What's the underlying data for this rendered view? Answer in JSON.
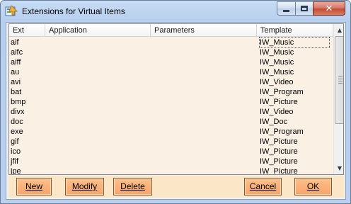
{
  "window": {
    "title": "Extensions for Virtual Items",
    "close_symbol": "✕"
  },
  "list": {
    "columns": [
      "Ext",
      "Application",
      "Parameters",
      "Template"
    ],
    "rows": [
      {
        "ext": "aif",
        "template": "IW_Music"
      },
      {
        "ext": "aifc",
        "template": "IW_Music"
      },
      {
        "ext": "aiff",
        "template": "IW_Music"
      },
      {
        "ext": "au",
        "template": "IW_Music"
      },
      {
        "ext": "avi",
        "template": "IW_Video"
      },
      {
        "ext": "bat",
        "template": "IW_Program"
      },
      {
        "ext": "bmp",
        "template": "IW_Picture"
      },
      {
        "ext": "divx",
        "template": "IW_Video"
      },
      {
        "ext": "doc",
        "template": "IW_Doc"
      },
      {
        "ext": "exe",
        "template": "IW_Program"
      },
      {
        "ext": "gif",
        "template": "IW_Picture"
      },
      {
        "ext": "ico",
        "template": "IW_Picture"
      },
      {
        "ext": "jfif",
        "template": "IW_Picture"
      },
      {
        "ext": "jpe",
        "template": "IW_Picture"
      }
    ]
  },
  "scrollbar": {
    "up_symbol": "▲",
    "down_symbol": "▼"
  },
  "buttons": {
    "new": "New",
    "modify": "Modify",
    "delete": "Delete",
    "cancel": "Cancel",
    "ok": "OK"
  },
  "colors": {
    "list_background": "#fbf0e4",
    "button_bar": "#fbe7c8",
    "button_fill": "#f8a46a"
  }
}
